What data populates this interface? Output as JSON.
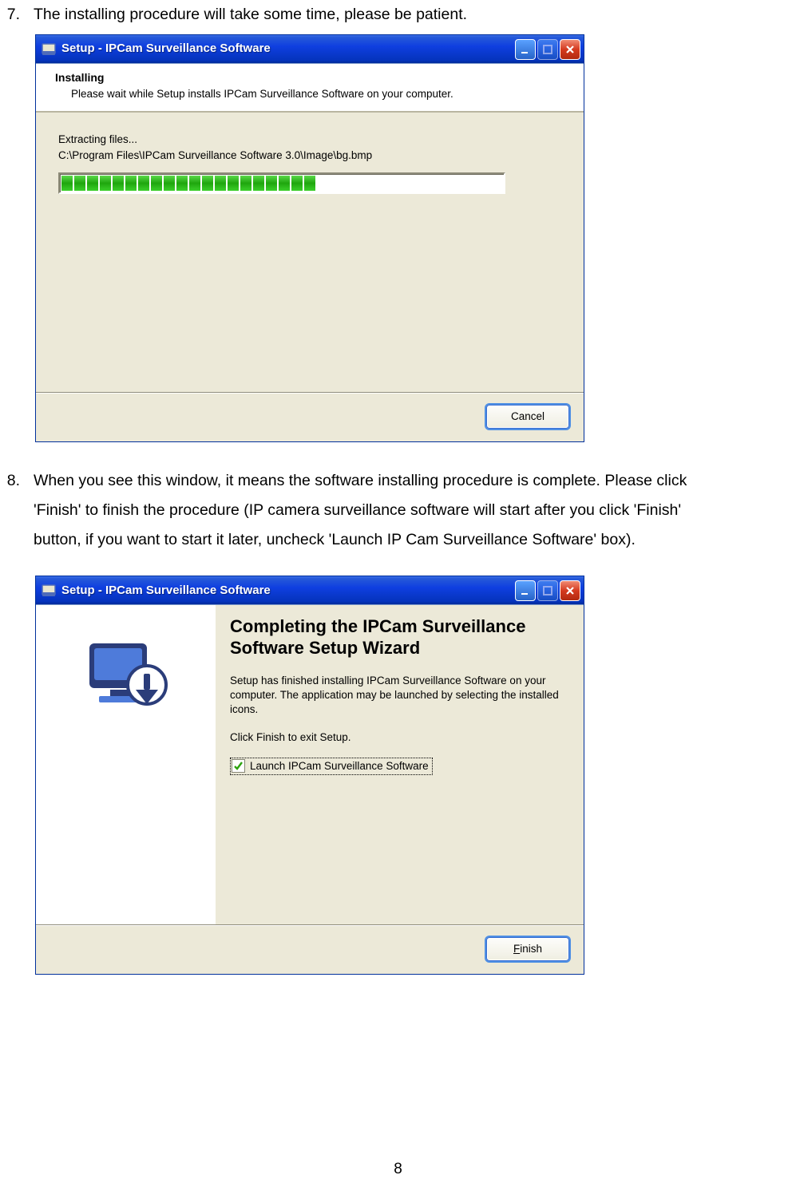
{
  "step7": {
    "num": "7.",
    "text": "The installing procedure will take some time, please be patient."
  },
  "step8": {
    "num": "8.",
    "line1": "When you see this window, it means the software installing procedure is complete. Please click",
    "line2": "'Finish' to finish the procedure (IP camera surveillance software will start after you click 'Finish'",
    "line3": "button, if you want to start it later, uncheck 'Launch IP Cam Surveillance Software' box)."
  },
  "dialog1": {
    "title": "Setup - IPCam Surveillance Software",
    "header_title": "Installing",
    "header_sub": "Please wait while Setup installs IPCam Surveillance Software on your computer.",
    "extracting": "Extracting files...",
    "path": "C:\\Program Files\\IPCam Surveillance Software 3.0\\Image\\bg.bmp",
    "cancel": "Cancel"
  },
  "dialog2": {
    "title": "Setup - IPCam Surveillance Software",
    "heading": "Completing the IPCam Surveillance Software Setup Wizard",
    "body1": "Setup has finished installing IPCam Surveillance Software on your computer. The application may be launched by selecting the installed icons.",
    "body2": "Click Finish to exit Setup.",
    "launch_prefix": "L",
    "launch_text": "aunch IPCam Surveillance Software",
    "finish_prefix": "F",
    "finish_text": "inish"
  },
  "page_number": "8"
}
